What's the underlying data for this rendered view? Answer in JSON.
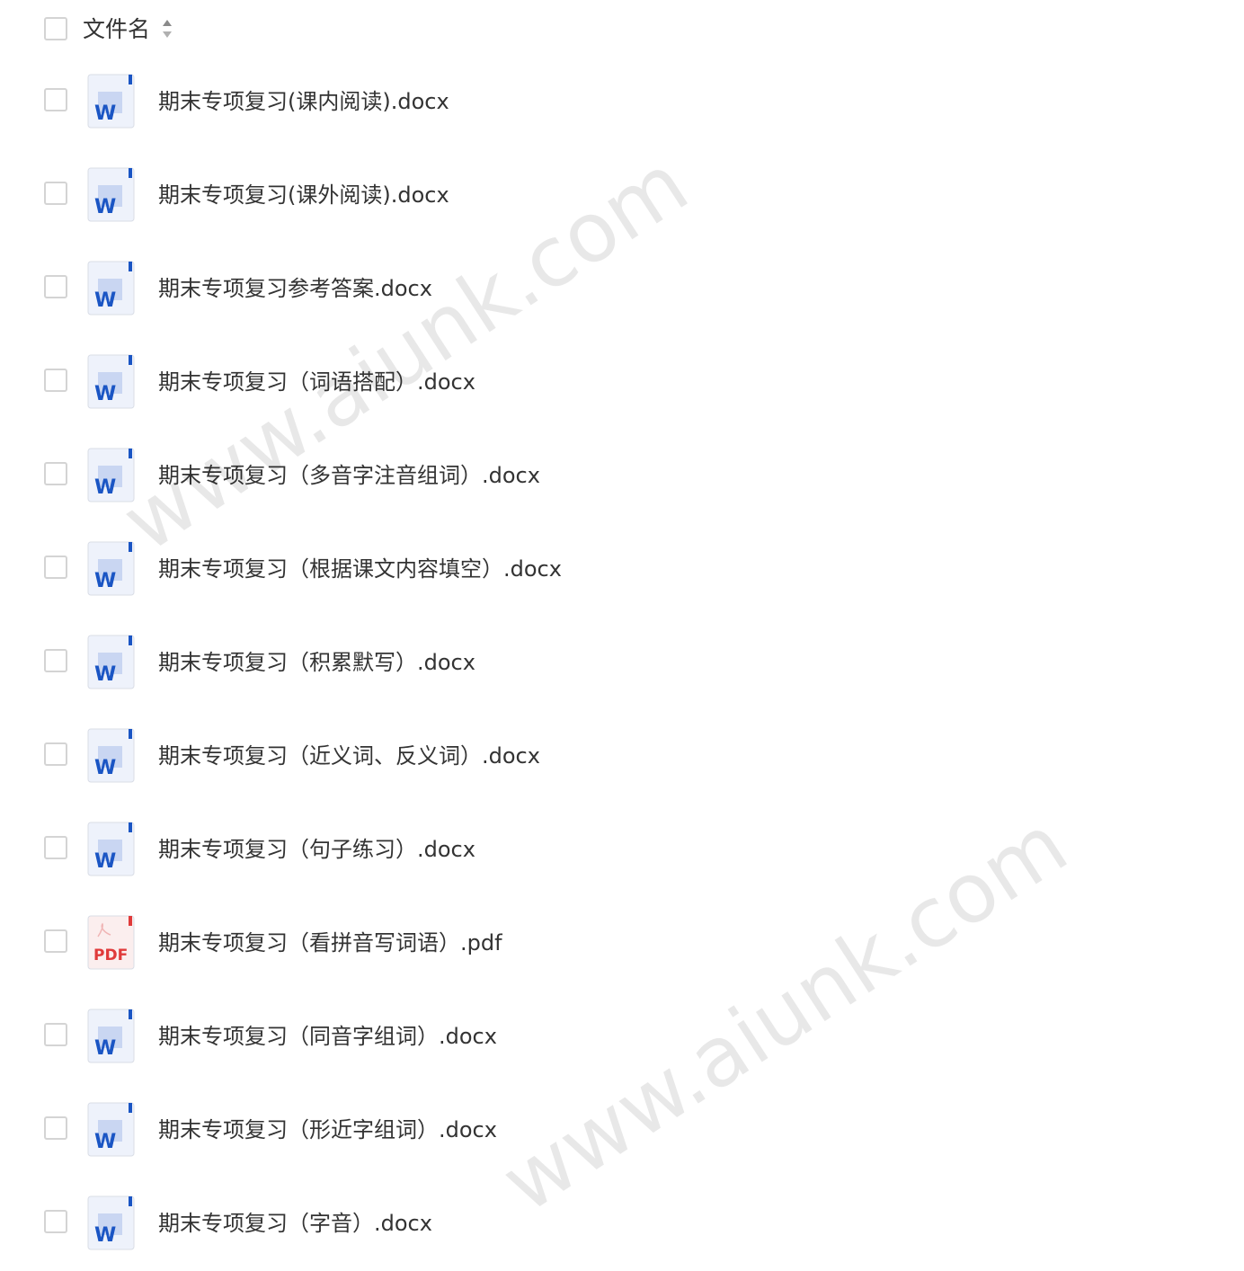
{
  "header": {
    "column_label": "文件名",
    "sort_icon": "sort-up-down-icon"
  },
  "colors": {
    "word_blue": "#1a55c4",
    "pdf_red": "#e03a3a",
    "checkbox_border": "#d4d4d4",
    "text": "#333333"
  },
  "files": [
    {
      "name": "期末专项复习(课内阅读).docx",
      "type": "word"
    },
    {
      "name": "期末专项复习(课外阅读).docx",
      "type": "word"
    },
    {
      "name": "期末专项复习参考答案.docx",
      "type": "word"
    },
    {
      "name": "期末专项复习（词语搭配）.docx",
      "type": "word"
    },
    {
      "name": "期末专项复习（多音字注音组词）.docx",
      "type": "word"
    },
    {
      "name": "期末专项复习（根据课文内容填空）.docx",
      "type": "word"
    },
    {
      "name": "期末专项复习（积累默写）.docx",
      "type": "word"
    },
    {
      "name": "期末专项复习（近义词、反义词）.docx",
      "type": "word"
    },
    {
      "name": "期末专项复习（句子练习）.docx",
      "type": "word"
    },
    {
      "name": "期末专项复习（看拼音写词语）.pdf",
      "type": "pdf"
    },
    {
      "name": "期末专项复习（同音字组词）.docx",
      "type": "word"
    },
    {
      "name": "期末专项复习（形近字组词）.docx",
      "type": "word"
    },
    {
      "name": "期末专项复习（字音）.docx",
      "type": "word"
    }
  ],
  "icon_labels": {
    "word": "W",
    "pdf": "PDF"
  },
  "watermark": {
    "text": "www.aiunk.com"
  }
}
